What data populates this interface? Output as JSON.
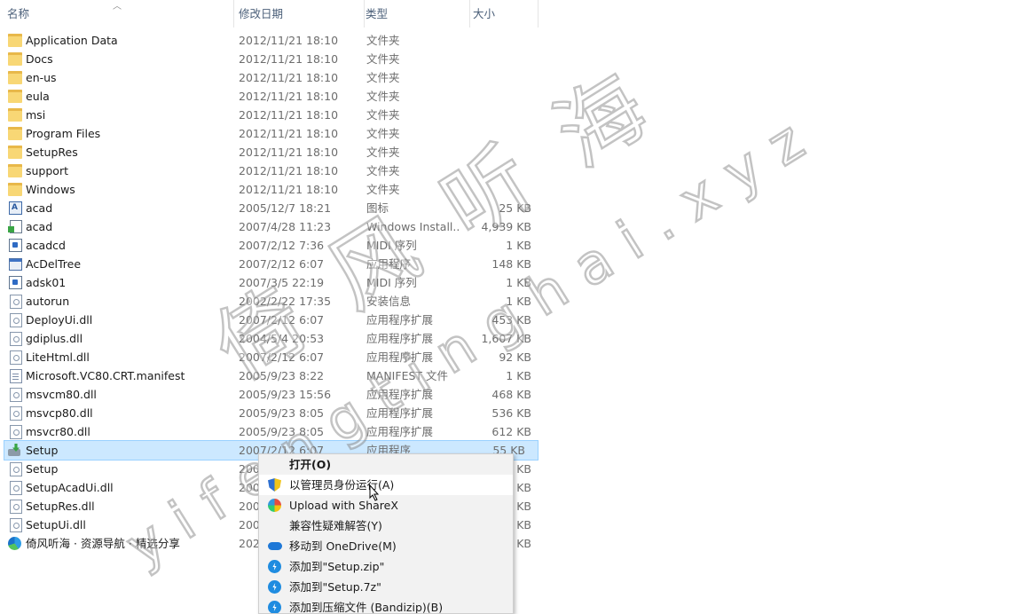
{
  "columns": {
    "name": "名称",
    "date": "修改日期",
    "type": "类型",
    "size": "大小"
  },
  "files": [
    {
      "name": "Application Data",
      "date": "2012/11/21 18:10",
      "type": "文件夹",
      "size": "",
      "icon": "folder-icon"
    },
    {
      "name": "Docs",
      "date": "2012/11/21 18:10",
      "type": "文件夹",
      "size": "",
      "icon": "folder-icon"
    },
    {
      "name": "en-us",
      "date": "2012/11/21 18:10",
      "type": "文件夹",
      "size": "",
      "icon": "folder-icon"
    },
    {
      "name": "eula",
      "date": "2012/11/21 18:10",
      "type": "文件夹",
      "size": "",
      "icon": "folder-icon"
    },
    {
      "name": "msi",
      "date": "2012/11/21 18:10",
      "type": "文件夹",
      "size": "",
      "icon": "folder-icon"
    },
    {
      "name": "Program Files",
      "date": "2012/11/21 18:10",
      "type": "文件夹",
      "size": "",
      "icon": "folder-icon"
    },
    {
      "name": "SetupRes",
      "date": "2012/11/21 18:10",
      "type": "文件夹",
      "size": "",
      "icon": "folder-icon"
    },
    {
      "name": "support",
      "date": "2012/11/21 18:10",
      "type": "文件夹",
      "size": "",
      "icon": "folder-icon"
    },
    {
      "name": "Windows",
      "date": "2012/11/21 18:10",
      "type": "文件夹",
      "size": "",
      "icon": "folder-icon"
    },
    {
      "name": "acad",
      "date": "2005/12/7 18:21",
      "type": "图标",
      "size": "25 KB",
      "icon": "autocad-icon"
    },
    {
      "name": "acad",
      "date": "2007/4/28 11:23",
      "type": "Windows Install...",
      "size": "4,939 KB",
      "icon": "installer-icon"
    },
    {
      "name": "acadcd",
      "date": "2007/2/12 7:36",
      "type": "MIDI 序列",
      "size": "1 KB",
      "icon": "midi-icon"
    },
    {
      "name": "AcDelTree",
      "date": "2007/2/12 6:07",
      "type": "应用程序",
      "size": "148 KB",
      "icon": "application-icon"
    },
    {
      "name": "adsk01",
      "date": "2007/3/5 22:19",
      "type": "MIDI 序列",
      "size": "1 KB",
      "icon": "midi-icon"
    },
    {
      "name": "autorun",
      "date": "2002/2/22 17:35",
      "type": "安装信息",
      "size": "1 KB",
      "icon": "setup-info-icon"
    },
    {
      "name": "DeployUi.dll",
      "date": "2007/2/12 6:07",
      "type": "应用程序扩展",
      "size": "453 KB",
      "icon": "dll-icon"
    },
    {
      "name": "gdiplus.dll",
      "date": "2004/5/4 20:53",
      "type": "应用程序扩展",
      "size": "1,607 KB",
      "icon": "dll-icon"
    },
    {
      "name": "LiteHtml.dll",
      "date": "2007/2/12 6:07",
      "type": "应用程序扩展",
      "size": "92 KB",
      "icon": "dll-icon"
    },
    {
      "name": "Microsoft.VC80.CRT.manifest",
      "date": "2005/9/23 8:22",
      "type": "MANIFEST 文件",
      "size": "1 KB",
      "icon": "file-icon"
    },
    {
      "name": "msvcm80.dll",
      "date": "2005/9/23 15:56",
      "type": "应用程序扩展",
      "size": "468 KB",
      "icon": "dll-icon"
    },
    {
      "name": "msvcp80.dll",
      "date": "2005/9/23 8:05",
      "type": "应用程序扩展",
      "size": "536 KB",
      "icon": "dll-icon"
    },
    {
      "name": "msvcr80.dll",
      "date": "2005/9/23 8:05",
      "type": "应用程序扩展",
      "size": "612 KB",
      "icon": "dll-icon"
    },
    {
      "name": "Setup",
      "date": "2007/2/12 6:07",
      "type": "应用程序",
      "size": "55 KB",
      "icon": "setup-exe-icon",
      "selected": true
    },
    {
      "name": "Setup",
      "date": "200",
      "type": "",
      "size": "KB",
      "icon": "dll-icon"
    },
    {
      "name": "SetupAcadUi.dll",
      "date": "200",
      "type": "",
      "size": "KB",
      "icon": "dll-icon"
    },
    {
      "name": "SetupRes.dll",
      "date": "200",
      "type": "",
      "size": "KB",
      "icon": "dll-icon"
    },
    {
      "name": "SetupUi.dll",
      "date": "200",
      "type": "",
      "size": "KB",
      "icon": "dll-icon"
    },
    {
      "name": "倚风听海 · 资源导航 · 精选分享",
      "date": "202",
      "type": "",
      "size": "KB",
      "icon": "web-shortcut-icon"
    }
  ],
  "context_menu": [
    {
      "label": "打开(O)",
      "icon": "",
      "bold": true
    },
    {
      "label": "以管理员身份运行(A)",
      "icon": "uac-shield-icon",
      "hover": true
    },
    {
      "label": "Upload with ShareX",
      "icon": "sharex-icon"
    },
    {
      "label": "兼容性疑难解答(Y)",
      "icon": ""
    },
    {
      "label": "移动到 OneDrive(M)",
      "icon": "onedrive-icon"
    },
    {
      "label": "添加到\"Setup.zip\"",
      "icon": "bandizip-icon"
    },
    {
      "label": "添加到\"Setup.7z\"",
      "icon": "bandizip-icon"
    },
    {
      "label": "添加到压缩文件 (Bandizip)(B)",
      "icon": "bandizip-icon"
    }
  ],
  "watermark": {
    "cn": "倚风听海",
    "url": "yifengtinghai.xyz"
  }
}
